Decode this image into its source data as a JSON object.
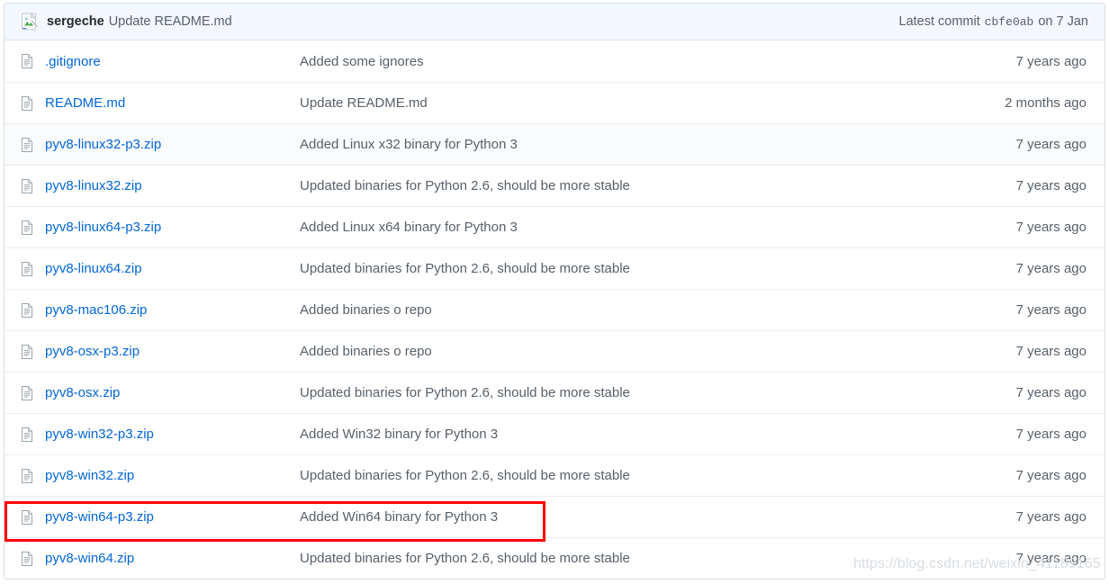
{
  "header": {
    "avatar_icon": "broken-image-icon",
    "author": "sergeche",
    "message": "Update README.md",
    "latest_commit_label": "Latest commit",
    "commit_sha": "cbfe0ab",
    "commit_date": "on 7 Jan"
  },
  "watermark": {
    "text": "https://blog.csdn.net/weixin_41189165"
  },
  "annotation": {
    "color": "#ff0000",
    "target_row": "pyv8-win64-p3.zip"
  },
  "colors": {
    "link": "#0366d6",
    "muted_text": "#586069",
    "header_bg": "#f1f8ff",
    "row_border": "#eaecef",
    "container_border": "#d8dee2",
    "stripe_bg": "#fafbfc",
    "annotation": "#ff0000"
  },
  "files": [
    {
      "icon": "file-icon",
      "name": ".gitignore",
      "message": "Added some ignores",
      "age": "7 years ago",
      "striped": false,
      "highlighted": false
    },
    {
      "icon": "file-icon",
      "name": "README.md",
      "message": "Update README.md",
      "age": "2 months ago",
      "striped": false,
      "highlighted": false
    },
    {
      "icon": "file-icon",
      "name": "pyv8-linux32-p3.zip",
      "message": "Added Linux x32 binary for Python 3",
      "age": "7 years ago",
      "striped": true,
      "highlighted": false
    },
    {
      "icon": "file-icon",
      "name": "pyv8-linux32.zip",
      "message": "Updated binaries for Python 2.6, should be more stable",
      "age": "7 years ago",
      "striped": false,
      "highlighted": false
    },
    {
      "icon": "file-icon",
      "name": "pyv8-linux64-p3.zip",
      "message": "Added Linux x64 binary for Python 3",
      "age": "7 years ago",
      "striped": false,
      "highlighted": false
    },
    {
      "icon": "file-icon",
      "name": "pyv8-linux64.zip",
      "message": "Updated binaries for Python 2.6, should be more stable",
      "age": "7 years ago",
      "striped": false,
      "highlighted": false
    },
    {
      "icon": "file-icon",
      "name": "pyv8-mac106.zip",
      "message": "Added binaries o repo",
      "age": "7 years ago",
      "striped": false,
      "highlighted": false
    },
    {
      "icon": "file-icon",
      "name": "pyv8-osx-p3.zip",
      "message": "Added binaries o repo",
      "age": "7 years ago",
      "striped": false,
      "highlighted": false
    },
    {
      "icon": "file-icon",
      "name": "pyv8-osx.zip",
      "message": "Updated binaries for Python 2.6, should be more stable",
      "age": "7 years ago",
      "striped": false,
      "highlighted": false
    },
    {
      "icon": "file-icon",
      "name": "pyv8-win32-p3.zip",
      "message": "Added Win32 binary for Python 3",
      "age": "7 years ago",
      "striped": false,
      "highlighted": false
    },
    {
      "icon": "file-icon",
      "name": "pyv8-win32.zip",
      "message": "Updated binaries for Python 2.6, should be more stable",
      "age": "7 years ago",
      "striped": false,
      "highlighted": false
    },
    {
      "icon": "file-icon",
      "name": "pyv8-win64-p3.zip",
      "message": "Added Win64 binary for Python 3",
      "age": "7 years ago",
      "striped": false,
      "highlighted": true
    },
    {
      "icon": "file-icon",
      "name": "pyv8-win64.zip",
      "message": "Updated binaries for Python 2.6, should be more stable",
      "age": "7 years ago",
      "striped": false,
      "highlighted": false
    }
  ]
}
